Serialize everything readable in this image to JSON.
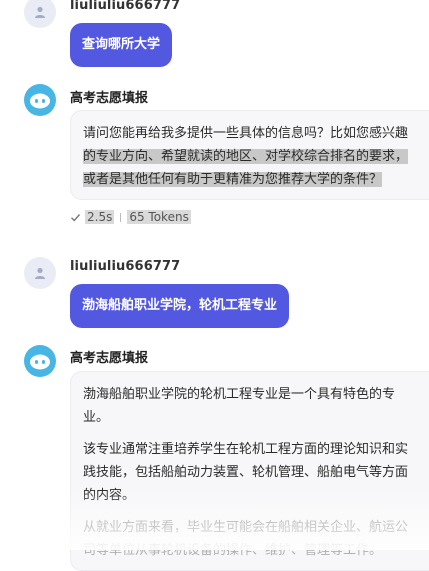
{
  "messages": {
    "m1": {
      "username": "liuliuliu666777",
      "text": "查询哪所大学"
    },
    "m2": {
      "bot_name": "高考志愿填报",
      "line1": "请问您能再给我多提供一些具体的信息吗？比如您感兴趣",
      "line2": "的专业方向、希望就读的地区、对学校综合排名的要求，",
      "line3": "或者是其他任何有助于更精准为您推荐大学的条件？",
      "time": "2.5s",
      "tokens": "65 Tokens"
    },
    "m3": {
      "username": "liuliuliu666777",
      "text": "渤海船舶职业学院，轮机工程专业"
    },
    "m4": {
      "bot_name": "高考志愿填报",
      "p1_l1": "渤海船舶职业学院的轮机工程专业是一个具有特色的专",
      "p1_l2": "业。",
      "p2_l1": "该专业通常注重培养学生在轮机工程方面的理论知识和实",
      "p2_l2": "践技能，包括船舶动力装置、轮机管理、船舶电气等方面",
      "p2_l3": "的内容。",
      "p3_l1": "从就业方面来看，毕业生可能会在船舶相关企业、航运公",
      "p3_l2": "司等单位从事轮机设备的操作、维护、管理等工作。"
    }
  }
}
